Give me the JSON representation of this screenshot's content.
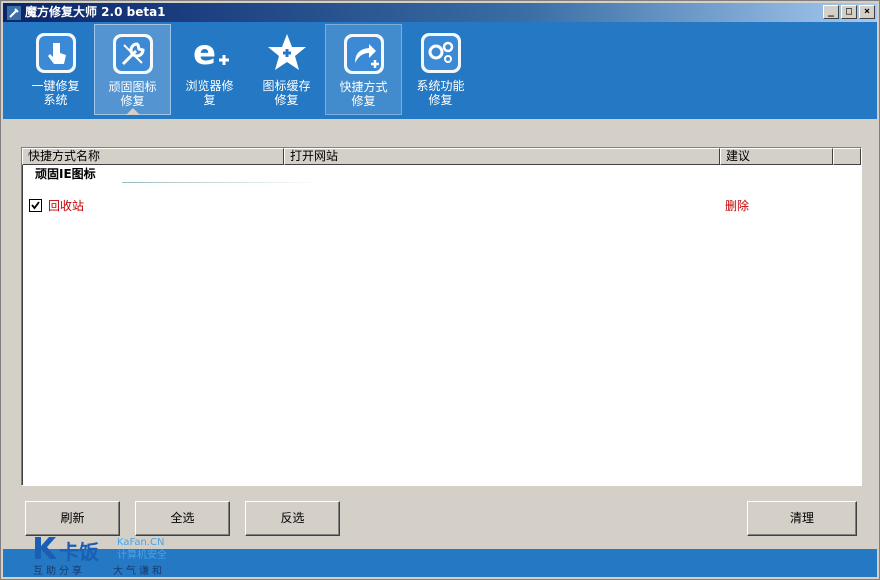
{
  "window": {
    "title": "魔方修复大师 2.0 beta1",
    "controls": {
      "minimize": "_",
      "maximize": "□",
      "close": "×"
    }
  },
  "toolbar": {
    "tabs": [
      {
        "label": "一键修复\n系统",
        "icon": "hand-touch-icon",
        "state": "normal"
      },
      {
        "label": "顽固图标\n修复",
        "icon": "wrench-tools-icon",
        "state": "active"
      },
      {
        "label": "浏览器修\n复",
        "icon": "browser-e-plus-icon",
        "state": "normal"
      },
      {
        "label": "图标缓存\n修复",
        "icon": "star-plus-icon",
        "state": "normal"
      },
      {
        "label": "快捷方式\n修复",
        "icon": "shortcut-arrow-icon",
        "state": "highlight"
      },
      {
        "label": "系统功能\n修复",
        "icon": "gears-icon",
        "state": "normal"
      }
    ]
  },
  "list": {
    "columns": [
      "快捷方式名称",
      "打开网站",
      "建议",
      ""
    ],
    "group": "顽固IE图标",
    "rows": [
      {
        "name": "回收站",
        "site": "",
        "action": "删除",
        "checked": true
      }
    ]
  },
  "buttons": {
    "refresh": "刷新",
    "select_all": "全选",
    "invert": "反选",
    "clean": "清理"
  },
  "watermark": {
    "brand": "卡饭",
    "domain": "KaFan.CN",
    "tagline": "计算机安全",
    "left_motto": "互助分享",
    "right_motto": "大气谦和"
  },
  "colors": {
    "toolbar_blue": "#2478c4",
    "alert_red": "#c00000",
    "window_gray": "#d4d0c8"
  }
}
